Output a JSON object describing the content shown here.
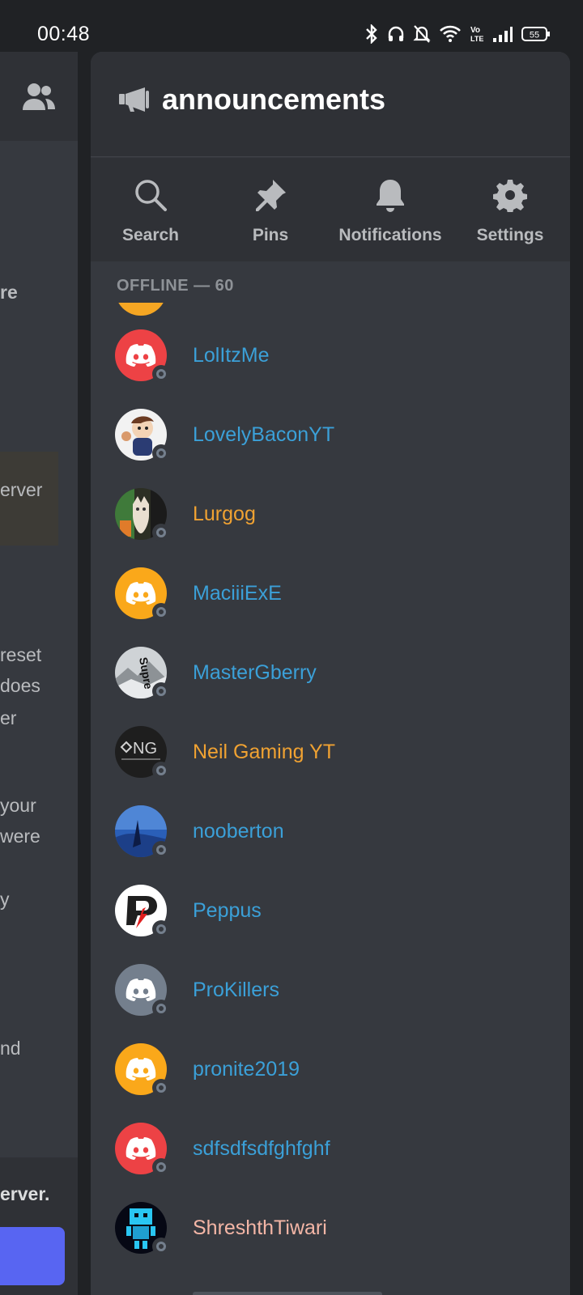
{
  "status_bar": {
    "time": "00:48",
    "battery": "55",
    "icons": [
      "bluetooth-icon",
      "headphones-icon",
      "bell-off-icon",
      "wifi-icon",
      "volte-icon",
      "signal-icon",
      "battery-icon"
    ]
  },
  "behind_panel": {
    "fragments": [
      "re",
      "erver",
      "reset",
      "does",
      "er",
      "your",
      "were",
      "y",
      "nd",
      "erver."
    ]
  },
  "channel": {
    "name": "announcements",
    "icon": "megaphone-icon"
  },
  "actions": [
    {
      "label": "Search",
      "icon": "search-icon"
    },
    {
      "label": "Pins",
      "icon": "pin-icon"
    },
    {
      "label": "Notifications",
      "icon": "bell-icon"
    },
    {
      "label": "Settings",
      "icon": "gear-icon"
    }
  ],
  "section": {
    "label": "OFFLINE — 60"
  },
  "members": [
    {
      "name": "LolItzMe",
      "color": "#3ba0d8",
      "avatar": "discord-red"
    },
    {
      "name": "LovelyBaconYT",
      "color": "#3ba0d8",
      "avatar": "cartoon"
    },
    {
      "name": "Lurgog",
      "color": "#f0a232",
      "avatar": "cat-photo"
    },
    {
      "name": "MaciiiExE",
      "color": "#3ba0d8",
      "avatar": "discord-yellow"
    },
    {
      "name": "MasterGberry",
      "color": "#3ba0d8",
      "avatar": "supreme"
    },
    {
      "name": "Neil Gaming YT",
      "color": "#f0a232",
      "avatar": "ng-logo"
    },
    {
      "name": "nooberton",
      "color": "#3ba0d8",
      "avatar": "blue-scene"
    },
    {
      "name": "Peppus",
      "color": "#3ba0d8",
      "avatar": "p-logo"
    },
    {
      "name": "ProKillers",
      "color": "#3ba0d8",
      "avatar": "discord-grey"
    },
    {
      "name": "pronite2019",
      "color": "#3ba0d8",
      "avatar": "discord-yellow"
    },
    {
      "name": "sdfsdfsdfghfghf",
      "color": "#3ba0d8",
      "avatar": "discord-red"
    },
    {
      "name": "ShreshthTiwari",
      "color": "#f4b6a6",
      "avatar": "pixel-robot"
    }
  ],
  "colors": {
    "blurple": "#5865f2",
    "offline_status": "#747f8d",
    "drawer_bg": "#36393f",
    "header_bg": "#2f3136"
  }
}
